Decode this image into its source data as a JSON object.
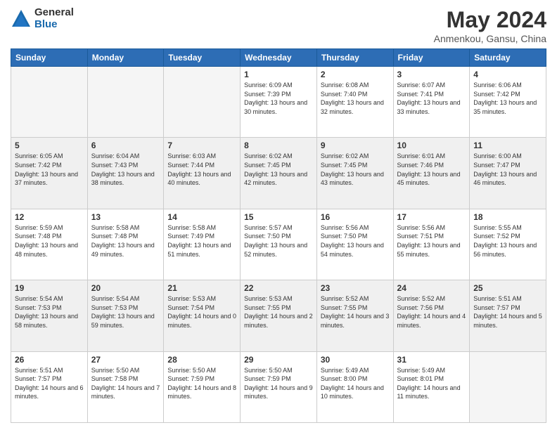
{
  "logo": {
    "general": "General",
    "blue": "Blue"
  },
  "title": "May 2024",
  "subtitle": "Anmenkou, Gansu, China",
  "days_of_week": [
    "Sunday",
    "Monday",
    "Tuesday",
    "Wednesday",
    "Thursday",
    "Friday",
    "Saturday"
  ],
  "weeks": [
    [
      {
        "day": "",
        "empty": true
      },
      {
        "day": "",
        "empty": true
      },
      {
        "day": "",
        "empty": true
      },
      {
        "day": "1",
        "sunrise": "6:09 AM",
        "sunset": "7:39 PM",
        "daylight": "13 hours and 30 minutes."
      },
      {
        "day": "2",
        "sunrise": "6:08 AM",
        "sunset": "7:40 PM",
        "daylight": "13 hours and 32 minutes."
      },
      {
        "day": "3",
        "sunrise": "6:07 AM",
        "sunset": "7:41 PM",
        "daylight": "13 hours and 33 minutes."
      },
      {
        "day": "4",
        "sunrise": "6:06 AM",
        "sunset": "7:42 PM",
        "daylight": "13 hours and 35 minutes."
      }
    ],
    [
      {
        "day": "5",
        "sunrise": "6:05 AM",
        "sunset": "7:42 PM",
        "daylight": "13 hours and 37 minutes."
      },
      {
        "day": "6",
        "sunrise": "6:04 AM",
        "sunset": "7:43 PM",
        "daylight": "13 hours and 38 minutes."
      },
      {
        "day": "7",
        "sunrise": "6:03 AM",
        "sunset": "7:44 PM",
        "daylight": "13 hours and 40 minutes."
      },
      {
        "day": "8",
        "sunrise": "6:02 AM",
        "sunset": "7:45 PM",
        "daylight": "13 hours and 42 minutes."
      },
      {
        "day": "9",
        "sunrise": "6:02 AM",
        "sunset": "7:45 PM",
        "daylight": "13 hours and 43 minutes."
      },
      {
        "day": "10",
        "sunrise": "6:01 AM",
        "sunset": "7:46 PM",
        "daylight": "13 hours and 45 minutes."
      },
      {
        "day": "11",
        "sunrise": "6:00 AM",
        "sunset": "7:47 PM",
        "daylight": "13 hours and 46 minutes."
      }
    ],
    [
      {
        "day": "12",
        "sunrise": "5:59 AM",
        "sunset": "7:48 PM",
        "daylight": "13 hours and 48 minutes."
      },
      {
        "day": "13",
        "sunrise": "5:58 AM",
        "sunset": "7:48 PM",
        "daylight": "13 hours and 49 minutes."
      },
      {
        "day": "14",
        "sunrise": "5:58 AM",
        "sunset": "7:49 PM",
        "daylight": "13 hours and 51 minutes."
      },
      {
        "day": "15",
        "sunrise": "5:57 AM",
        "sunset": "7:50 PM",
        "daylight": "13 hours and 52 minutes."
      },
      {
        "day": "16",
        "sunrise": "5:56 AM",
        "sunset": "7:50 PM",
        "daylight": "13 hours and 54 minutes."
      },
      {
        "day": "17",
        "sunrise": "5:56 AM",
        "sunset": "7:51 PM",
        "daylight": "13 hours and 55 minutes."
      },
      {
        "day": "18",
        "sunrise": "5:55 AM",
        "sunset": "7:52 PM",
        "daylight": "13 hours and 56 minutes."
      }
    ],
    [
      {
        "day": "19",
        "sunrise": "5:54 AM",
        "sunset": "7:53 PM",
        "daylight": "13 hours and 58 minutes."
      },
      {
        "day": "20",
        "sunrise": "5:54 AM",
        "sunset": "7:53 PM",
        "daylight": "13 hours and 59 minutes."
      },
      {
        "day": "21",
        "sunrise": "5:53 AM",
        "sunset": "7:54 PM",
        "daylight": "14 hours and 0 minutes."
      },
      {
        "day": "22",
        "sunrise": "5:53 AM",
        "sunset": "7:55 PM",
        "daylight": "14 hours and 2 minutes."
      },
      {
        "day": "23",
        "sunrise": "5:52 AM",
        "sunset": "7:55 PM",
        "daylight": "14 hours and 3 minutes."
      },
      {
        "day": "24",
        "sunrise": "5:52 AM",
        "sunset": "7:56 PM",
        "daylight": "14 hours and 4 minutes."
      },
      {
        "day": "25",
        "sunrise": "5:51 AM",
        "sunset": "7:57 PM",
        "daylight": "14 hours and 5 minutes."
      }
    ],
    [
      {
        "day": "26",
        "sunrise": "5:51 AM",
        "sunset": "7:57 PM",
        "daylight": "14 hours and 6 minutes."
      },
      {
        "day": "27",
        "sunrise": "5:50 AM",
        "sunset": "7:58 PM",
        "daylight": "14 hours and 7 minutes."
      },
      {
        "day": "28",
        "sunrise": "5:50 AM",
        "sunset": "7:59 PM",
        "daylight": "14 hours and 8 minutes."
      },
      {
        "day": "29",
        "sunrise": "5:50 AM",
        "sunset": "7:59 PM",
        "daylight": "14 hours and 9 minutes."
      },
      {
        "day": "30",
        "sunrise": "5:49 AM",
        "sunset": "8:00 PM",
        "daylight": "14 hours and 10 minutes."
      },
      {
        "day": "31",
        "sunrise": "5:49 AM",
        "sunset": "8:01 PM",
        "daylight": "14 hours and 11 minutes."
      },
      {
        "day": "",
        "empty": true
      }
    ]
  ]
}
